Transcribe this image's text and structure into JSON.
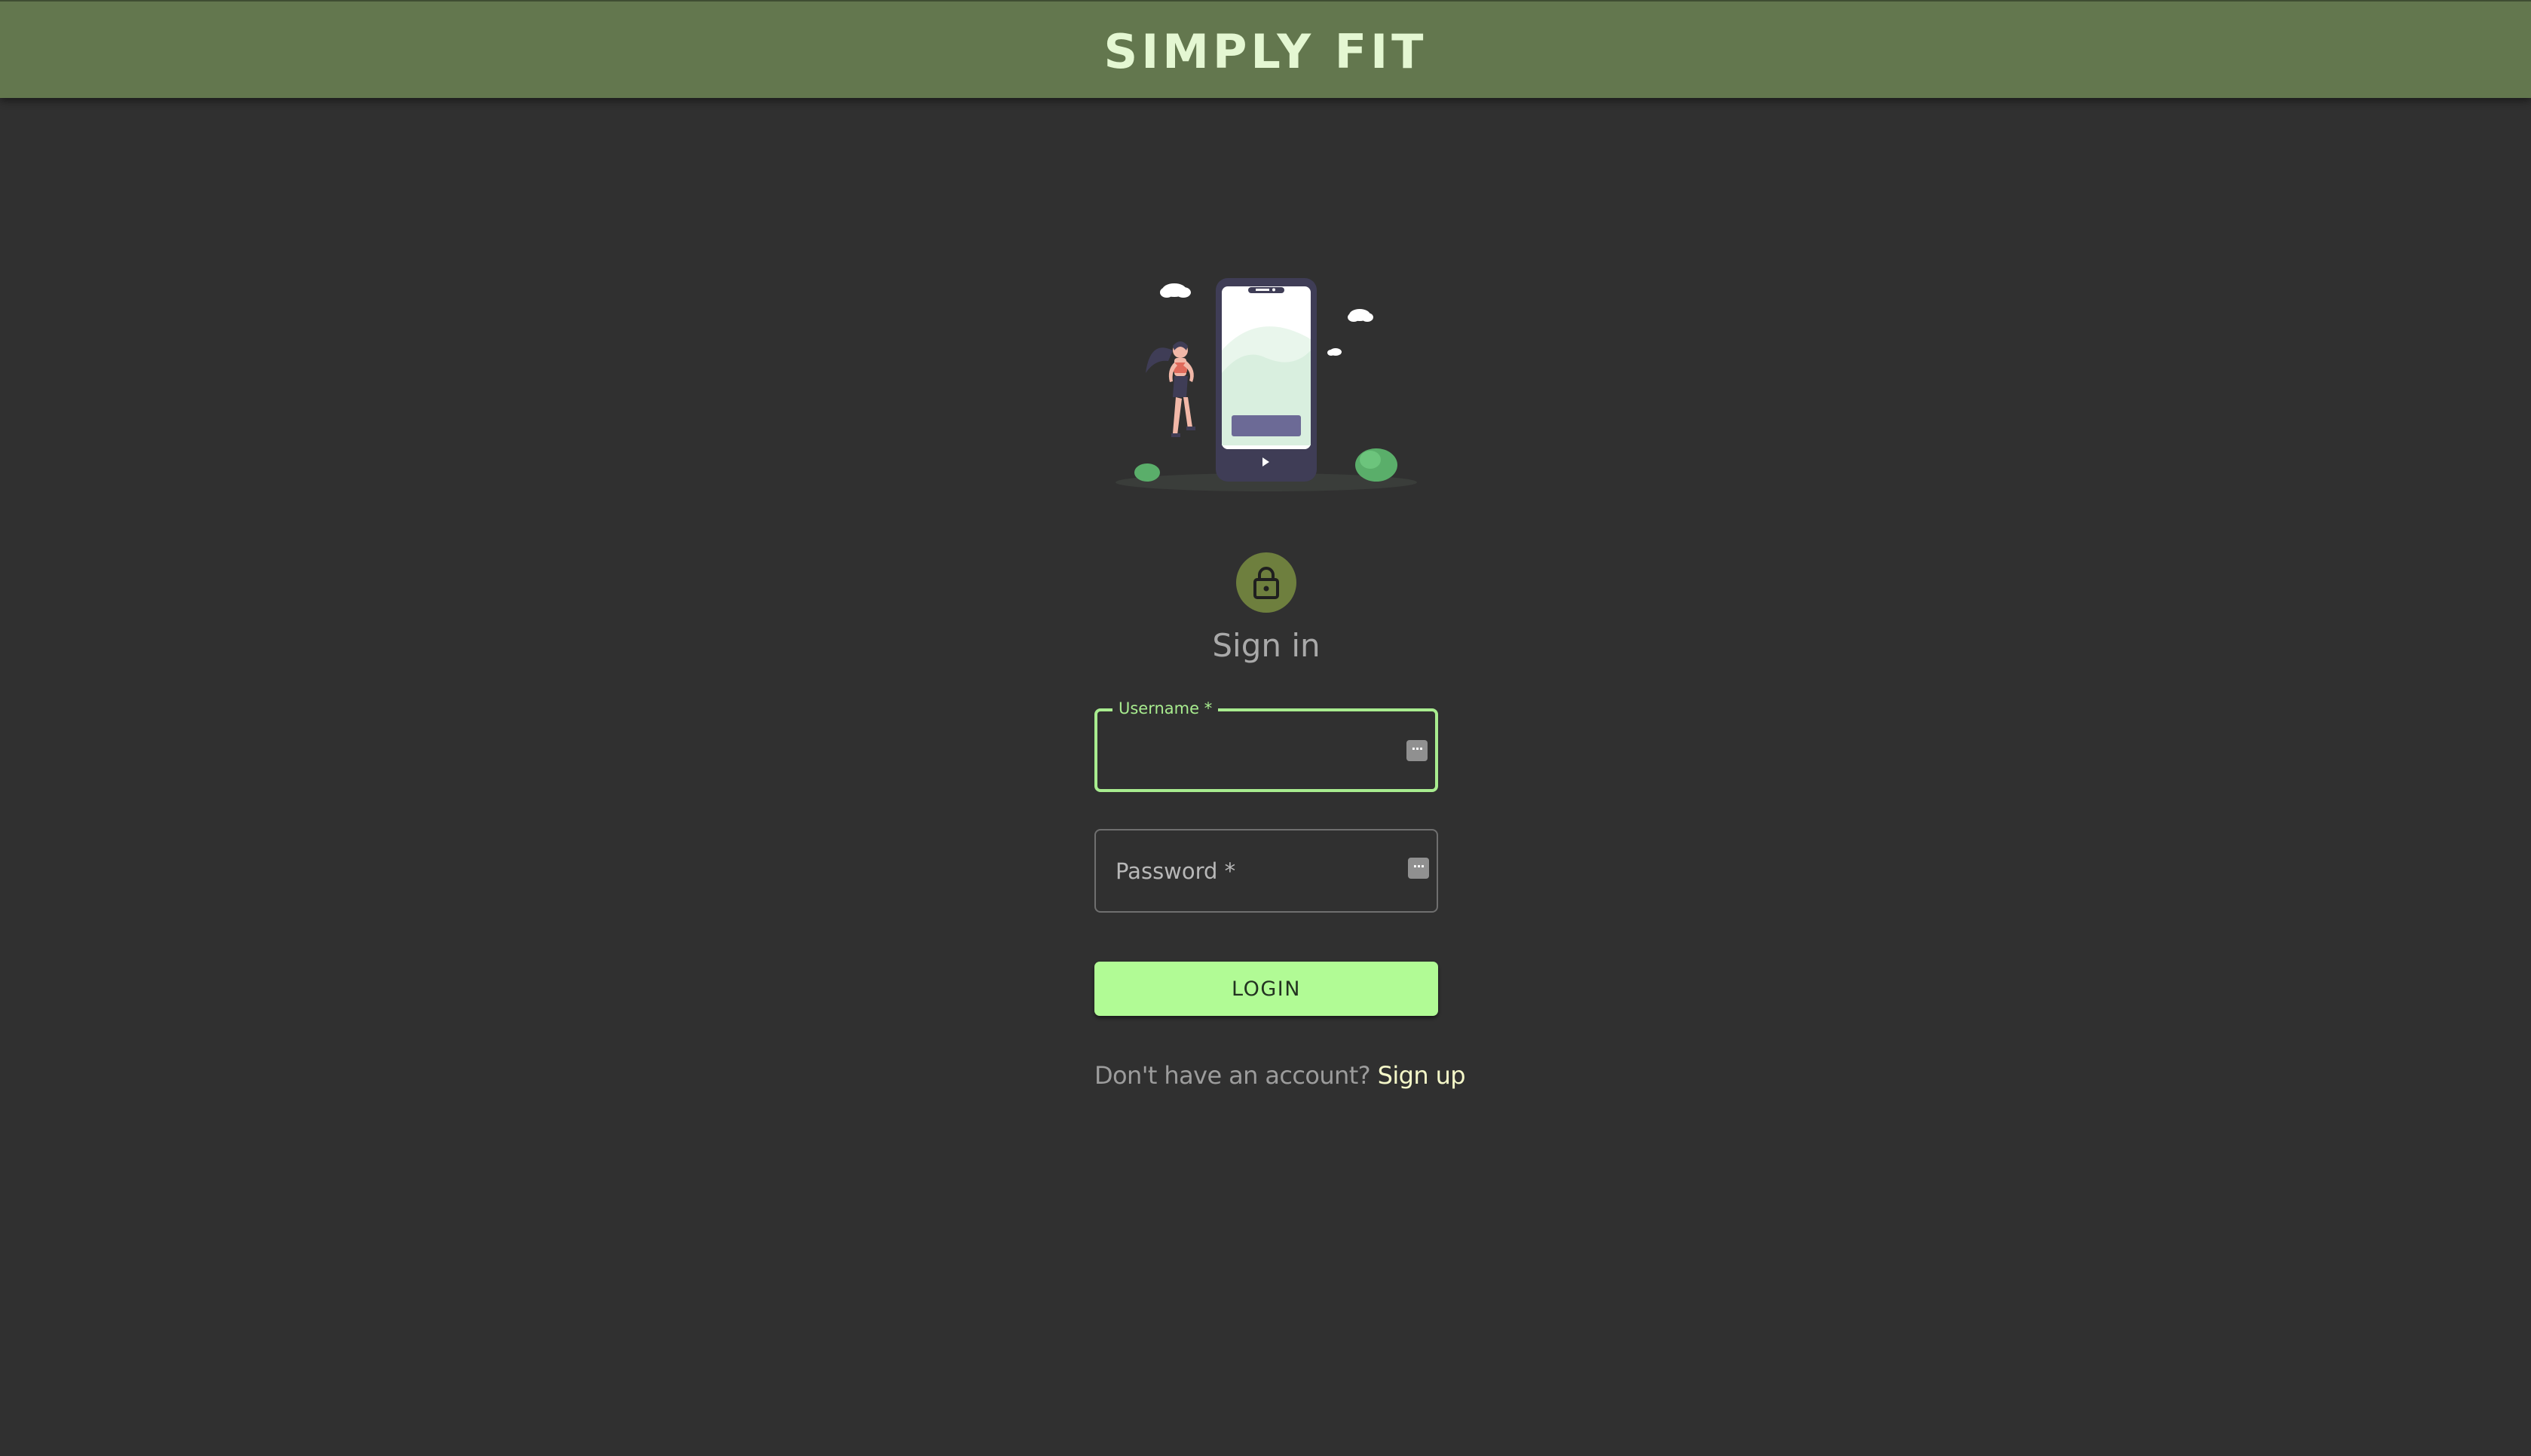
{
  "header": {
    "title": "SIMPLY FIT"
  },
  "signin": {
    "heading": "Sign in",
    "username_label": "Username *",
    "username_value": "",
    "password_label": "Password *",
    "password_value": "",
    "login_label": "LOGIN",
    "signup_prompt": "Don't have an account?",
    "signup_link": "Sign up"
  },
  "icons": {
    "avatar": "lock-icon",
    "field_action": "password-manager-icon"
  },
  "colors": {
    "header_bg": "#63774e",
    "header_text": "#e4f7d2",
    "page_bg": "#303030",
    "accent": "#a8ec8f",
    "button_bg": "#b1fb95",
    "avatar_bg": "#6e7f3e",
    "link": "#f4f7c8"
  }
}
